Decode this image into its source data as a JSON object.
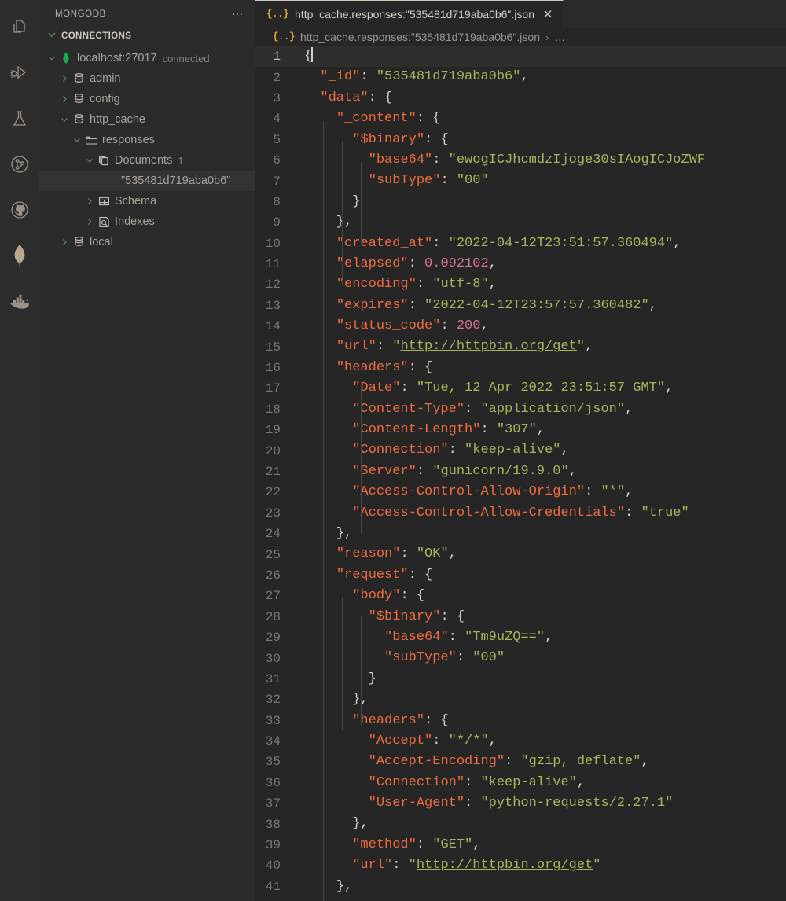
{
  "activity_bar": {
    "items": [
      {
        "name": "explorer-icon",
        "label": "Explorer"
      },
      {
        "name": "run-and-debug-icon",
        "label": "Run and Debug"
      },
      {
        "name": "testing-flask-icon",
        "label": "Testing"
      },
      {
        "name": "source-control-icon",
        "label": "Source Control"
      },
      {
        "name": "github-icon",
        "label": "GitHub"
      },
      {
        "name": "mongodb-leaf-icon",
        "label": "MongoDB"
      },
      {
        "name": "docker-whale-icon",
        "label": "Docker"
      }
    ]
  },
  "sidebar": {
    "title": "MONGODB",
    "more_actions": "…",
    "section": {
      "label": "CONNECTIONS",
      "expanded": true
    },
    "tree": [
      {
        "label": "localhost:27017",
        "description": "connected",
        "icon": "mongodb-leaf-icon",
        "twisty": "chevron-down",
        "indent": 0,
        "selected": false
      },
      {
        "label": "admin",
        "description": "",
        "icon": "database-icon",
        "twisty": "chevron-right",
        "indent": 1,
        "selected": false
      },
      {
        "label": "config",
        "description": "",
        "icon": "database-icon",
        "twisty": "chevron-right",
        "indent": 1,
        "selected": false
      },
      {
        "label": "http_cache",
        "description": "",
        "icon": "database-icon",
        "twisty": "chevron-down",
        "indent": 1,
        "selected": false
      },
      {
        "label": "responses",
        "description": "",
        "icon": "folder-icon",
        "twisty": "chevron-down",
        "indent": 2,
        "selected": false
      },
      {
        "label": "Documents",
        "description": "1",
        "icon": "documents-icon",
        "twisty": "chevron-down",
        "indent": 3,
        "selected": false
      },
      {
        "label": "\"535481d719aba0b6\"",
        "description": "",
        "icon": "",
        "twisty": "",
        "indent": 5,
        "selected": true
      },
      {
        "label": "Schema",
        "description": "",
        "icon": "schema-table-icon",
        "twisty": "chevron-right",
        "indent": 3,
        "selected": false
      },
      {
        "label": "Indexes",
        "description": "",
        "icon": "indexes-icon",
        "twisty": "chevron-right",
        "indent": 3,
        "selected": false
      },
      {
        "label": "local",
        "description": "",
        "icon": "database-icon",
        "twisty": "chevron-right",
        "indent": 1,
        "selected": false
      }
    ]
  },
  "editor": {
    "tab": {
      "badge": "{..}",
      "label": "http_cache.responses:\"535481d719aba0b6\".json",
      "close": "✕",
      "active": true
    },
    "breadcrumbs": {
      "badge": "{..}",
      "file": "http_cache.responses:\"535481d719aba0b6\".json",
      "separator": "›",
      "more": "…"
    },
    "cursor_line": 1,
    "lines": [
      {
        "no": 1,
        "tokens": [
          {
            "t": "{",
            "c": "p"
          }
        ],
        "caret": true
      },
      {
        "no": 2,
        "tokens": [
          {
            "t": "  ",
            "c": "p"
          },
          {
            "t": "\"_id\"",
            "c": "k"
          },
          {
            "t": ": ",
            "c": "p"
          },
          {
            "t": "\"535481d719aba0b6\"",
            "c": "s"
          },
          {
            "t": ",",
            "c": "p"
          }
        ]
      },
      {
        "no": 3,
        "tokens": [
          {
            "t": "  ",
            "c": "p"
          },
          {
            "t": "\"data\"",
            "c": "k"
          },
          {
            "t": ": {",
            "c": "p"
          }
        ]
      },
      {
        "no": 4,
        "tokens": [
          {
            "t": "    ",
            "c": "p"
          },
          {
            "t": "\"_content\"",
            "c": "k"
          },
          {
            "t": ": {",
            "c": "p"
          }
        ]
      },
      {
        "no": 5,
        "tokens": [
          {
            "t": "      ",
            "c": "p"
          },
          {
            "t": "\"$binary\"",
            "c": "k"
          },
          {
            "t": ": {",
            "c": "p"
          }
        ]
      },
      {
        "no": 6,
        "tokens": [
          {
            "t": "        ",
            "c": "p"
          },
          {
            "t": "\"base64\"",
            "c": "k"
          },
          {
            "t": ": ",
            "c": "p"
          },
          {
            "t": "\"ewogICJhcmdzIjoge30sIAogICJoZWF",
            "c": "s"
          }
        ]
      },
      {
        "no": 7,
        "tokens": [
          {
            "t": "        ",
            "c": "p"
          },
          {
            "t": "\"subType\"",
            "c": "k"
          },
          {
            "t": ": ",
            "c": "p"
          },
          {
            "t": "\"00\"",
            "c": "s"
          }
        ]
      },
      {
        "no": 8,
        "tokens": [
          {
            "t": "      }",
            "c": "p"
          }
        ]
      },
      {
        "no": 9,
        "tokens": [
          {
            "t": "    },",
            "c": "p"
          }
        ]
      },
      {
        "no": 10,
        "tokens": [
          {
            "t": "    ",
            "c": "p"
          },
          {
            "t": "\"created_at\"",
            "c": "k"
          },
          {
            "t": ": ",
            "c": "p"
          },
          {
            "t": "\"2022-04-12T23:51:57.360494\"",
            "c": "s"
          },
          {
            "t": ",",
            "c": "p"
          }
        ]
      },
      {
        "no": 11,
        "tokens": [
          {
            "t": "    ",
            "c": "p"
          },
          {
            "t": "\"elapsed\"",
            "c": "k"
          },
          {
            "t": ": ",
            "c": "p"
          },
          {
            "t": "0.092102",
            "c": "n"
          },
          {
            "t": ",",
            "c": "p"
          }
        ]
      },
      {
        "no": 12,
        "tokens": [
          {
            "t": "    ",
            "c": "p"
          },
          {
            "t": "\"encoding\"",
            "c": "k"
          },
          {
            "t": ": ",
            "c": "p"
          },
          {
            "t": "\"utf-8\"",
            "c": "s"
          },
          {
            "t": ",",
            "c": "p"
          }
        ]
      },
      {
        "no": 13,
        "tokens": [
          {
            "t": "    ",
            "c": "p"
          },
          {
            "t": "\"expires\"",
            "c": "k"
          },
          {
            "t": ": ",
            "c": "p"
          },
          {
            "t": "\"2022-04-12T23:57:57.360482\"",
            "c": "s"
          },
          {
            "t": ",",
            "c": "p"
          }
        ]
      },
      {
        "no": 14,
        "tokens": [
          {
            "t": "    ",
            "c": "p"
          },
          {
            "t": "\"status_code\"",
            "c": "k"
          },
          {
            "t": ": ",
            "c": "p"
          },
          {
            "t": "200",
            "c": "n"
          },
          {
            "t": ",",
            "c": "p"
          }
        ]
      },
      {
        "no": 15,
        "tokens": [
          {
            "t": "    ",
            "c": "p"
          },
          {
            "t": "\"url\"",
            "c": "k"
          },
          {
            "t": ": ",
            "c": "p"
          },
          {
            "t": "\"",
            "c": "s"
          },
          {
            "t": "http://httpbin.org/get",
            "c": "u"
          },
          {
            "t": "\"",
            "c": "s"
          },
          {
            "t": ",",
            "c": "p"
          }
        ]
      },
      {
        "no": 16,
        "tokens": [
          {
            "t": "    ",
            "c": "p"
          },
          {
            "t": "\"headers\"",
            "c": "k"
          },
          {
            "t": ": {",
            "c": "p"
          }
        ]
      },
      {
        "no": 17,
        "tokens": [
          {
            "t": "      ",
            "c": "p"
          },
          {
            "t": "\"Date\"",
            "c": "k"
          },
          {
            "t": ": ",
            "c": "p"
          },
          {
            "t": "\"Tue, 12 Apr 2022 23:51:57 GMT\"",
            "c": "s"
          },
          {
            "t": ",",
            "c": "p"
          }
        ]
      },
      {
        "no": 18,
        "tokens": [
          {
            "t": "      ",
            "c": "p"
          },
          {
            "t": "\"Content-Type\"",
            "c": "k"
          },
          {
            "t": ": ",
            "c": "p"
          },
          {
            "t": "\"application/json\"",
            "c": "s"
          },
          {
            "t": ",",
            "c": "p"
          }
        ]
      },
      {
        "no": 19,
        "tokens": [
          {
            "t": "      ",
            "c": "p"
          },
          {
            "t": "\"Content-Length\"",
            "c": "k"
          },
          {
            "t": ": ",
            "c": "p"
          },
          {
            "t": "\"307\"",
            "c": "s"
          },
          {
            "t": ",",
            "c": "p"
          }
        ]
      },
      {
        "no": 20,
        "tokens": [
          {
            "t": "      ",
            "c": "p"
          },
          {
            "t": "\"Connection\"",
            "c": "k"
          },
          {
            "t": ": ",
            "c": "p"
          },
          {
            "t": "\"keep-alive\"",
            "c": "s"
          },
          {
            "t": ",",
            "c": "p"
          }
        ]
      },
      {
        "no": 21,
        "tokens": [
          {
            "t": "      ",
            "c": "p"
          },
          {
            "t": "\"Server\"",
            "c": "k"
          },
          {
            "t": ": ",
            "c": "p"
          },
          {
            "t": "\"gunicorn/19.9.0\"",
            "c": "s"
          },
          {
            "t": ",",
            "c": "p"
          }
        ]
      },
      {
        "no": 22,
        "tokens": [
          {
            "t": "      ",
            "c": "p"
          },
          {
            "t": "\"Access-Control-Allow-Origin\"",
            "c": "k"
          },
          {
            "t": ": ",
            "c": "p"
          },
          {
            "t": "\"*\"",
            "c": "s"
          },
          {
            "t": ",",
            "c": "p"
          }
        ]
      },
      {
        "no": 23,
        "tokens": [
          {
            "t": "      ",
            "c": "p"
          },
          {
            "t": "\"Access-Control-Allow-Credentials\"",
            "c": "k"
          },
          {
            "t": ": ",
            "c": "p"
          },
          {
            "t": "\"true\"",
            "c": "s"
          }
        ]
      },
      {
        "no": 24,
        "tokens": [
          {
            "t": "    },",
            "c": "p"
          }
        ]
      },
      {
        "no": 25,
        "tokens": [
          {
            "t": "    ",
            "c": "p"
          },
          {
            "t": "\"reason\"",
            "c": "k"
          },
          {
            "t": ": ",
            "c": "p"
          },
          {
            "t": "\"OK\"",
            "c": "s"
          },
          {
            "t": ",",
            "c": "p"
          }
        ]
      },
      {
        "no": 26,
        "tokens": [
          {
            "t": "    ",
            "c": "p"
          },
          {
            "t": "\"request\"",
            "c": "k"
          },
          {
            "t": ": {",
            "c": "p"
          }
        ]
      },
      {
        "no": 27,
        "tokens": [
          {
            "t": "      ",
            "c": "p"
          },
          {
            "t": "\"body\"",
            "c": "k"
          },
          {
            "t": ": {",
            "c": "p"
          }
        ]
      },
      {
        "no": 28,
        "tokens": [
          {
            "t": "        ",
            "c": "p"
          },
          {
            "t": "\"$binary\"",
            "c": "k"
          },
          {
            "t": ": {",
            "c": "p"
          }
        ]
      },
      {
        "no": 29,
        "tokens": [
          {
            "t": "          ",
            "c": "p"
          },
          {
            "t": "\"base64\"",
            "c": "k"
          },
          {
            "t": ": ",
            "c": "p"
          },
          {
            "t": "\"Tm9uZQ==\"",
            "c": "s"
          },
          {
            "t": ",",
            "c": "p"
          }
        ]
      },
      {
        "no": 30,
        "tokens": [
          {
            "t": "          ",
            "c": "p"
          },
          {
            "t": "\"subType\"",
            "c": "k"
          },
          {
            "t": ": ",
            "c": "p"
          },
          {
            "t": "\"00\"",
            "c": "s"
          }
        ]
      },
      {
        "no": 31,
        "tokens": [
          {
            "t": "        }",
            "c": "p"
          }
        ]
      },
      {
        "no": 32,
        "tokens": [
          {
            "t": "      },",
            "c": "p"
          }
        ]
      },
      {
        "no": 33,
        "tokens": [
          {
            "t": "      ",
            "c": "p"
          },
          {
            "t": "\"headers\"",
            "c": "k"
          },
          {
            "t": ": {",
            "c": "p"
          }
        ]
      },
      {
        "no": 34,
        "tokens": [
          {
            "t": "        ",
            "c": "p"
          },
          {
            "t": "\"Accept\"",
            "c": "k"
          },
          {
            "t": ": ",
            "c": "p"
          },
          {
            "t": "\"*/*\"",
            "c": "s"
          },
          {
            "t": ",",
            "c": "p"
          }
        ]
      },
      {
        "no": 35,
        "tokens": [
          {
            "t": "        ",
            "c": "p"
          },
          {
            "t": "\"Accept-Encoding\"",
            "c": "k"
          },
          {
            "t": ": ",
            "c": "p"
          },
          {
            "t": "\"gzip, deflate\"",
            "c": "s"
          },
          {
            "t": ",",
            "c": "p"
          }
        ]
      },
      {
        "no": 36,
        "tokens": [
          {
            "t": "        ",
            "c": "p"
          },
          {
            "t": "\"Connection\"",
            "c": "k"
          },
          {
            "t": ": ",
            "c": "p"
          },
          {
            "t": "\"keep-alive\"",
            "c": "s"
          },
          {
            "t": ",",
            "c": "p"
          }
        ]
      },
      {
        "no": 37,
        "tokens": [
          {
            "t": "        ",
            "c": "p"
          },
          {
            "t": "\"User-Agent\"",
            "c": "k"
          },
          {
            "t": ": ",
            "c": "p"
          },
          {
            "t": "\"python-requests/2.27.1\"",
            "c": "s"
          }
        ]
      },
      {
        "no": 38,
        "tokens": [
          {
            "t": "      },",
            "c": "p"
          }
        ]
      },
      {
        "no": 39,
        "tokens": [
          {
            "t": "      ",
            "c": "p"
          },
          {
            "t": "\"method\"",
            "c": "k"
          },
          {
            "t": ": ",
            "c": "p"
          },
          {
            "t": "\"GET\"",
            "c": "s"
          },
          {
            "t": ",",
            "c": "p"
          }
        ]
      },
      {
        "no": 40,
        "tokens": [
          {
            "t": "      ",
            "c": "p"
          },
          {
            "t": "\"url\"",
            "c": "k"
          },
          {
            "t": ": ",
            "c": "p"
          },
          {
            "t": "\"",
            "c": "s"
          },
          {
            "t": "http://httpbin.org/get",
            "c": "u"
          },
          {
            "t": "\"",
            "c": "s"
          }
        ]
      },
      {
        "no": 41,
        "tokens": [
          {
            "t": "    },",
            "c": "p"
          }
        ]
      }
    ]
  },
  "colors": {
    "background": "#262626",
    "sidebar_background": "#2b2b2b",
    "activity_background": "#2d2d2d",
    "key": "#ef6c3e",
    "string": "#a2b85a",
    "number": "#d4728f",
    "punctuation": "#d8d2c8",
    "mongodb_green": "#13aa52",
    "json_badge": "#e0a82e",
    "selected_row": "#333331"
  }
}
